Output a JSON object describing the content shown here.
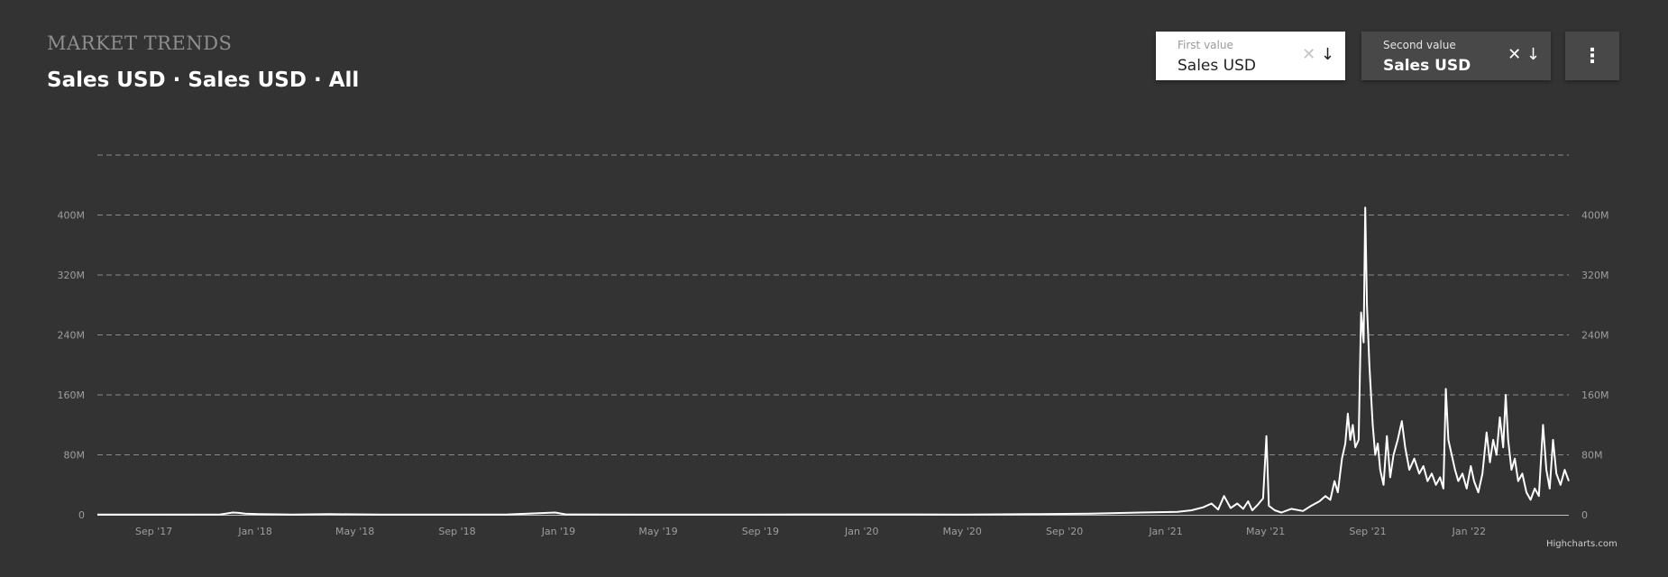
{
  "header": {
    "section_label": "MARKET TRENDS",
    "title": "Sales USD · Sales USD · All"
  },
  "controls": {
    "first_value": {
      "label": "First value",
      "value": "Sales USD",
      "clear_icon": "close-icon",
      "dropdown_icon": "arrow-down-icon"
    },
    "second_value": {
      "label": "Second value",
      "value": "Sales USD",
      "clear_icon": "close-icon",
      "dropdown_icon": "arrow-down-icon"
    },
    "menu_icon": "more-vertical-icon",
    "menu_glyph": "⋮"
  },
  "colors": {
    "background": "#333333",
    "line": "#ffffff",
    "grid": "#8a8a8a",
    "tick_text": "#9e9e9e"
  },
  "chart_data": {
    "type": "line",
    "title": "",
    "xlabel": "",
    "ylabel": "",
    "ylim": [
      0,
      480000000
    ],
    "yticks": [
      0,
      80000000,
      160000000,
      240000000,
      320000000,
      400000000
    ],
    "ytick_labels": [
      "0",
      "80M",
      "160M",
      "240M",
      "320M",
      "400M"
    ],
    "y_right_axis": true,
    "grid": true,
    "legend": "none",
    "xlim": [
      "2017-06-25",
      "2022-05-01"
    ],
    "xticks": [
      "2017-09-01",
      "2018-01-01",
      "2018-05-01",
      "2018-09-01",
      "2019-01-01",
      "2019-05-01",
      "2019-09-01",
      "2020-01-01",
      "2020-05-01",
      "2020-09-01",
      "2021-01-01",
      "2021-05-01",
      "2021-09-01",
      "2022-01-01"
    ],
    "xtick_labels": [
      "Sep '17",
      "Jan '18",
      "May '18",
      "Sep '18",
      "Jan '19",
      "May '19",
      "Sep '19",
      "Jan '20",
      "May '20",
      "Sep '20",
      "Jan '21",
      "May '21",
      "Sep '21",
      "Jan '22"
    ],
    "series": [
      {
        "color": "#ffffff",
        "points": [
          [
            "2017-06-25",
            200000
          ],
          [
            "2017-09-01",
            300000
          ],
          [
            "2017-11-20",
            500000
          ],
          [
            "2017-12-05",
            3000000
          ],
          [
            "2017-12-12",
            2500000
          ],
          [
            "2017-12-20",
            1500000
          ],
          [
            "2018-01-05",
            1000000
          ],
          [
            "2018-02-15",
            300000
          ],
          [
            "2018-04-01",
            800000
          ],
          [
            "2018-06-01",
            200000
          ],
          [
            "2018-09-01",
            400000
          ],
          [
            "2018-11-01",
            500000
          ],
          [
            "2018-12-28",
            3000000
          ],
          [
            "2019-01-10",
            500000
          ],
          [
            "2019-04-01",
            300000
          ],
          [
            "2019-09-01",
            400000
          ],
          [
            "2020-01-01",
            500000
          ],
          [
            "2020-05-01",
            400000
          ],
          [
            "2020-08-01",
            1000000
          ],
          [
            "2020-10-01",
            1500000
          ],
          [
            "2020-12-01",
            3000000
          ],
          [
            "2021-01-15",
            4000000
          ],
          [
            "2021-02-01",
            6000000
          ],
          [
            "2021-02-15",
            10000000
          ],
          [
            "2021-02-25",
            15000000
          ],
          [
            "2021-03-05",
            7000000
          ],
          [
            "2021-03-12",
            25000000
          ],
          [
            "2021-03-20",
            9000000
          ],
          [
            "2021-03-28",
            15000000
          ],
          [
            "2021-04-04",
            8000000
          ],
          [
            "2021-04-10",
            18000000
          ],
          [
            "2021-04-15",
            6000000
          ],
          [
            "2021-04-22",
            14000000
          ],
          [
            "2021-04-28",
            22000000
          ],
          [
            "2021-05-02",
            105000000
          ],
          [
            "2021-05-05",
            12000000
          ],
          [
            "2021-05-12",
            6000000
          ],
          [
            "2021-05-20",
            3000000
          ],
          [
            "2021-06-01",
            8000000
          ],
          [
            "2021-06-15",
            5000000
          ],
          [
            "2021-06-25",
            12000000
          ],
          [
            "2021-07-05",
            18000000
          ],
          [
            "2021-07-12",
            25000000
          ],
          [
            "2021-07-18",
            20000000
          ],
          [
            "2021-07-23",
            45000000
          ],
          [
            "2021-07-27",
            30000000
          ],
          [
            "2021-08-01",
            75000000
          ],
          [
            "2021-08-05",
            95000000
          ],
          [
            "2021-08-08",
            135000000
          ],
          [
            "2021-08-11",
            100000000
          ],
          [
            "2021-08-14",
            120000000
          ],
          [
            "2021-08-17",
            90000000
          ],
          [
            "2021-08-21",
            100000000
          ],
          [
            "2021-08-24",
            270000000
          ],
          [
            "2021-08-27",
            230000000
          ],
          [
            "2021-08-29",
            410000000
          ],
          [
            "2021-08-31",
            280000000
          ],
          [
            "2021-09-03",
            200000000
          ],
          [
            "2021-09-07",
            120000000
          ],
          [
            "2021-09-10",
            80000000
          ],
          [
            "2021-09-13",
            95000000
          ],
          [
            "2021-09-16",
            60000000
          ],
          [
            "2021-09-20",
            40000000
          ],
          [
            "2021-09-24",
            105000000
          ],
          [
            "2021-09-28",
            50000000
          ],
          [
            "2021-10-02",
            80000000
          ],
          [
            "2021-10-07",
            100000000
          ],
          [
            "2021-10-12",
            125000000
          ],
          [
            "2021-10-16",
            90000000
          ],
          [
            "2021-10-21",
            60000000
          ],
          [
            "2021-10-27",
            75000000
          ],
          [
            "2021-11-02",
            55000000
          ],
          [
            "2021-11-07",
            65000000
          ],
          [
            "2021-11-12",
            45000000
          ],
          [
            "2021-11-17",
            55000000
          ],
          [
            "2021-11-22",
            40000000
          ],
          [
            "2021-11-27",
            50000000
          ],
          [
            "2021-12-01",
            35000000
          ],
          [
            "2021-12-04",
            168000000
          ],
          [
            "2021-12-07",
            100000000
          ],
          [
            "2021-12-11",
            80000000
          ],
          [
            "2021-12-15",
            60000000
          ],
          [
            "2021-12-19",
            45000000
          ],
          [
            "2021-12-24",
            55000000
          ],
          [
            "2021-12-29",
            35000000
          ],
          [
            "2022-01-03",
            65000000
          ],
          [
            "2022-01-07",
            45000000
          ],
          [
            "2022-01-12",
            30000000
          ],
          [
            "2022-01-17",
            55000000
          ],
          [
            "2022-01-22",
            110000000
          ],
          [
            "2022-01-26",
            70000000
          ],
          [
            "2022-01-30",
            100000000
          ],
          [
            "2022-02-03",
            80000000
          ],
          [
            "2022-02-07",
            130000000
          ],
          [
            "2022-02-11",
            90000000
          ],
          [
            "2022-02-14",
            160000000
          ],
          [
            "2022-02-17",
            100000000
          ],
          [
            "2022-02-21",
            60000000
          ],
          [
            "2022-02-25",
            75000000
          ],
          [
            "2022-03-01",
            45000000
          ],
          [
            "2022-03-06",
            55000000
          ],
          [
            "2022-03-11",
            30000000
          ],
          [
            "2022-03-16",
            20000000
          ],
          [
            "2022-03-21",
            35000000
          ],
          [
            "2022-03-26",
            25000000
          ],
          [
            "2022-03-31",
            120000000
          ],
          [
            "2022-04-04",
            60000000
          ],
          [
            "2022-04-08",
            35000000
          ],
          [
            "2022-04-12",
            100000000
          ],
          [
            "2022-04-16",
            55000000
          ],
          [
            "2022-04-21",
            40000000
          ],
          [
            "2022-04-26",
            60000000
          ],
          [
            "2022-05-01",
            45000000
          ]
        ]
      }
    ]
  },
  "credits": "Highcharts.com"
}
